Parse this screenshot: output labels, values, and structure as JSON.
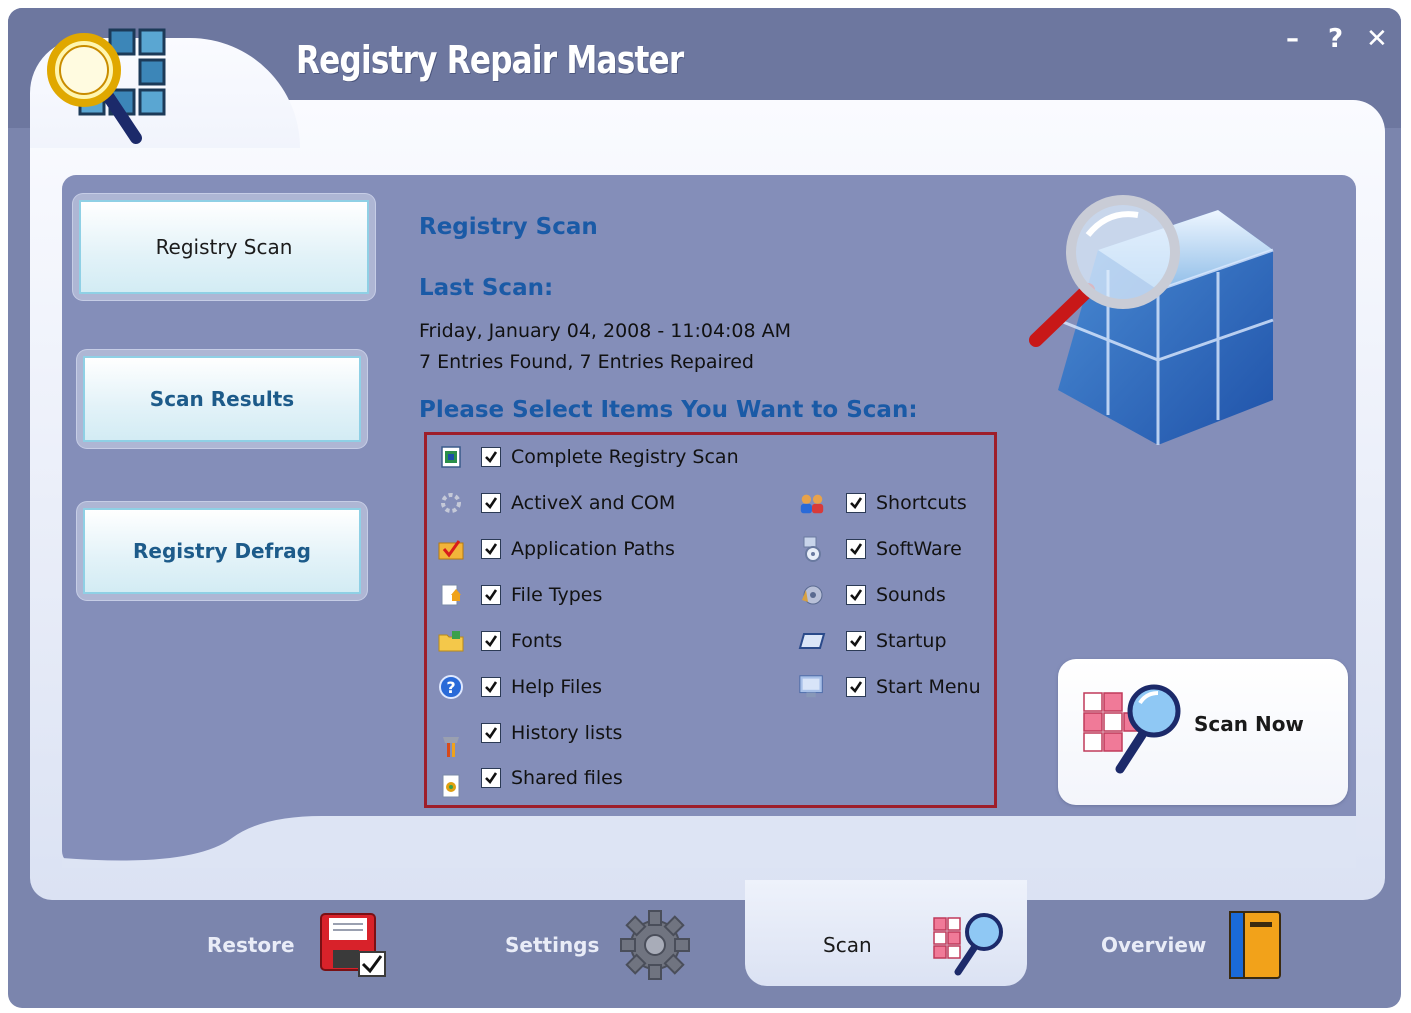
{
  "window": {
    "title": "Registry Repair Master",
    "controls": {
      "minimize": "–",
      "help": "?",
      "close": "✕"
    }
  },
  "sidebar": {
    "buttons": [
      {
        "label": "Registry Scan",
        "active": true
      },
      {
        "label": "Scan Results",
        "active": false
      },
      {
        "label": "Registry Defrag",
        "active": false
      }
    ]
  },
  "main": {
    "section_title": "Registry Scan",
    "last_scan_label": "Last Scan:",
    "last_scan_date": "Friday, January 04, 2008 - 11:04:08 AM",
    "last_scan_summary": "7 Entries Found, 7 Entries Repaired",
    "select_label": "Please Select Items You Want to Scan:"
  },
  "scan_items": {
    "complete": {
      "label": "Complete Registry Scan",
      "checked": true,
      "icon": "complete-scan-icon"
    },
    "left": [
      {
        "label": "ActiveX and COM",
        "checked": true,
        "icon": "activex-icon"
      },
      {
        "label": "Application Paths",
        "checked": true,
        "icon": "application-paths-icon"
      },
      {
        "label": "File Types",
        "checked": true,
        "icon": "file-types-icon"
      },
      {
        "label": "Fonts",
        "checked": true,
        "icon": "fonts-folder-icon"
      },
      {
        "label": "Help Files",
        "checked": true,
        "icon": "help-icon"
      },
      {
        "label": "History lists",
        "checked": true,
        "icon": "history-icon"
      },
      {
        "label": "Shared files",
        "checked": true,
        "icon": "shared-files-icon"
      }
    ],
    "right": [
      {
        "label": "Shortcuts",
        "checked": true,
        "icon": "shortcuts-icon"
      },
      {
        "label": "SoftWare",
        "checked": true,
        "icon": "software-icon"
      },
      {
        "label": "Sounds",
        "checked": true,
        "icon": "sounds-icon"
      },
      {
        "label": "Startup",
        "checked": true,
        "icon": "startup-icon"
      },
      {
        "label": "Start Menu",
        "checked": true,
        "icon": "start-menu-icon"
      }
    ]
  },
  "scan_now": {
    "label": "Scan Now"
  },
  "tabs": [
    {
      "label": "Restore",
      "icon": "floppy-disk-icon",
      "active": false
    },
    {
      "label": "Settings",
      "icon": "gear-icon",
      "active": false
    },
    {
      "label": "Scan",
      "icon": "scan-magnifier-icon",
      "active": true
    },
    {
      "label": "Overview",
      "icon": "book-icon",
      "active": false
    }
  ],
  "colors": {
    "frame": "#7b85ad",
    "panel": "#848eb9",
    "heading": "#1a5aa6",
    "highlight_border": "#9e1e2a"
  }
}
